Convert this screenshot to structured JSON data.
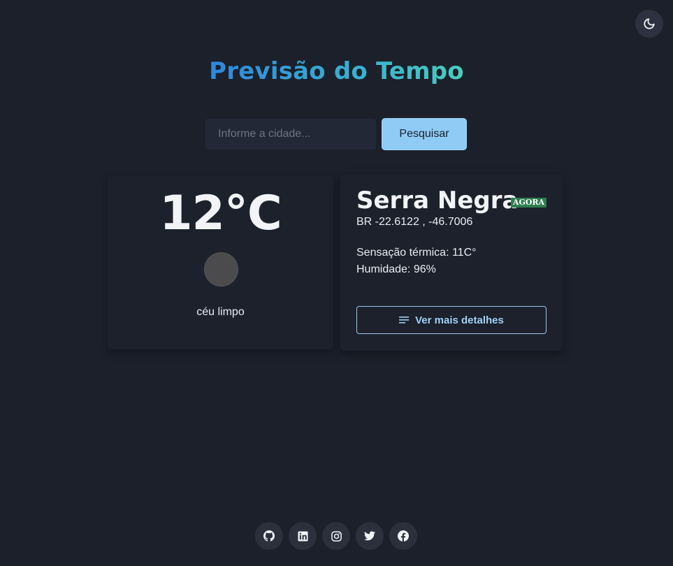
{
  "header": {
    "title": "Previsão do Tempo",
    "theme_toggle_icon": "moon-icon"
  },
  "search": {
    "placeholder": "Informe a cidade...",
    "value": "",
    "button_label": "Pesquisar"
  },
  "weather": {
    "temperature": "12°C",
    "icon": "weather-condition-icon",
    "description": "céu limpo"
  },
  "location": {
    "city": "Serra Negra",
    "badge": "AGORA",
    "coordinates": "BR -22.6122 , -46.7006",
    "feels_like": "Sensação térmica: 11C°",
    "humidity": "Humidade: 96%",
    "details_button_label": "Ver mais detalhes"
  },
  "footer": {
    "social_icons": [
      "github-icon",
      "linkedin-icon",
      "instagram-icon",
      "twitter-icon",
      "facebook-icon"
    ]
  },
  "colors": {
    "background": "#1b202b",
    "card": "#1c212c",
    "accent_button": "#8fcbf5",
    "badge": "#2f7d50",
    "title_gradient_start": "#2f86db",
    "title_gradient_end": "#49cdbd"
  }
}
